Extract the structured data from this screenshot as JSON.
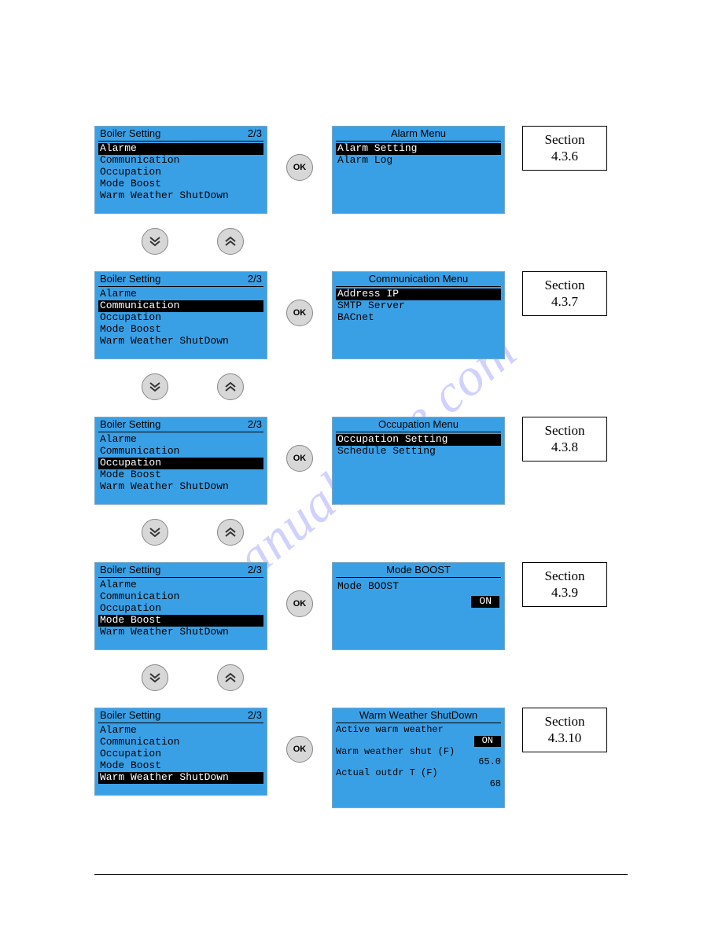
{
  "watermark": "manualshive.com",
  "left_screens": [
    {
      "title": "Boiler Setting",
      "page": "2/3",
      "items": [
        "Alarme",
        "Communication",
        "Occupation",
        "Mode Boost",
        "Warm Weather ShutDown"
      ],
      "selected_index": 0
    },
    {
      "title": "Boiler Setting",
      "page": "2/3",
      "items": [
        "Alarme",
        "Communication",
        "Occupation",
        "Mode Boost",
        "Warm Weather ShutDown"
      ],
      "selected_index": 1
    },
    {
      "title": "Boiler Setting",
      "page": "2/3",
      "items": [
        "Alarme",
        "Communication",
        "Occupation",
        "Mode Boost",
        "Warm Weather ShutDown"
      ],
      "selected_index": 2
    },
    {
      "title": "Boiler Setting",
      "page": "2/3",
      "items": [
        "Alarme",
        "Communication",
        "Occupation",
        "Mode Boost",
        "Warm Weather ShutDown"
      ],
      "selected_index": 3
    },
    {
      "title": "Boiler Setting",
      "page": "2/3",
      "items": [
        "Alarme",
        "Communication",
        "Occupation",
        "Mode Boost",
        "Warm Weather ShutDown"
      ],
      "selected_index": 4
    }
  ],
  "right_screens": [
    {
      "kind": "menu",
      "title": "Alarm Menu",
      "items": [
        "Alarm Setting",
        "Alarm Log"
      ],
      "selected_index": 0
    },
    {
      "kind": "menu",
      "title": "Communication Menu",
      "items": [
        "Address IP",
        "SMTP Server",
        "BACnet"
      ],
      "selected_index": 0
    },
    {
      "kind": "menu",
      "title": "Occupation Menu",
      "items": [
        "Occupation Setting",
        "Schedule Setting"
      ],
      "selected_index": 0
    },
    {
      "kind": "boost",
      "title": "Mode BOOST",
      "label": "Mode BOOST",
      "value": "ON"
    },
    {
      "kind": "wws",
      "title": "Warm Weather ShutDown",
      "rows": [
        {
          "label": "Active warm weather",
          "value": "ON",
          "boxed": true
        },
        {
          "label": "Warm weather shut (F)",
          "value": "65.0",
          "boxed": false
        },
        {
          "label": "Actual outdr T (F)",
          "value": "68",
          "boxed": false
        }
      ]
    }
  ],
  "sections": [
    {
      "word": "Section",
      "num": "4.3.6"
    },
    {
      "word": "Section",
      "num": "4.3.7"
    },
    {
      "word": "Section",
      "num": "4.3.8"
    },
    {
      "word": "Section",
      "num": "4.3.9"
    },
    {
      "word": "Section",
      "num": "4.3.10"
    }
  ],
  "ok_label": "OK"
}
